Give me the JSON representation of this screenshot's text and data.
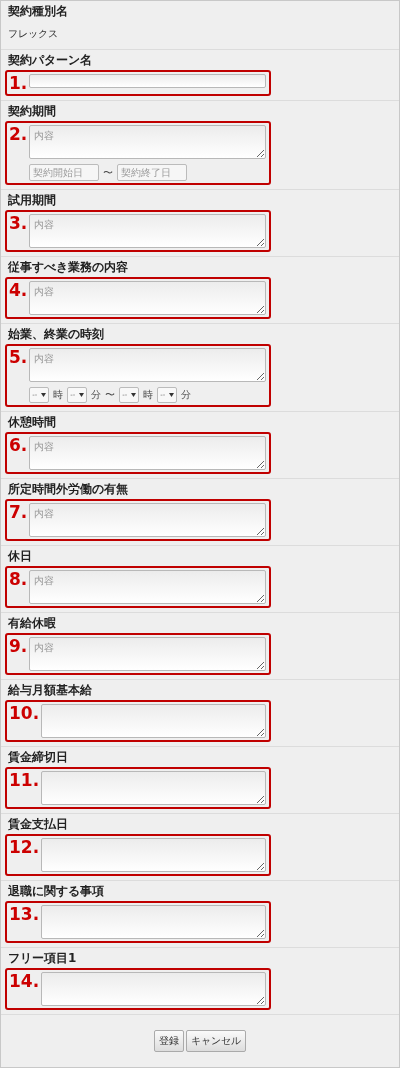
{
  "sections": [
    {
      "kind": "static",
      "label": "契約種別名",
      "value": "フレックス"
    },
    {
      "kind": "input",
      "label": "契約パターン名",
      "number": "1."
    },
    {
      "kind": "dates",
      "label": "契約期間",
      "number": "2.",
      "placeholder": "内容",
      "start_placeholder": "契約開始日",
      "separator": "〜",
      "end_placeholder": "契約終了日"
    },
    {
      "kind": "textarea",
      "label": "試用期間",
      "number": "3.",
      "placeholder": "内容"
    },
    {
      "kind": "textarea",
      "label": "従事すべき業務の内容",
      "number": "4.",
      "placeholder": "内容"
    },
    {
      "kind": "times",
      "label": "始業、終業の時刻",
      "number": "5.",
      "placeholder": "内容",
      "parts": [
        {
          "kind": "select",
          "value": "--"
        },
        {
          "kind": "text",
          "text": "時"
        },
        {
          "kind": "select",
          "value": "--"
        },
        {
          "kind": "text",
          "text": "分"
        },
        {
          "kind": "text",
          "text": "〜"
        },
        {
          "kind": "select",
          "value": "--"
        },
        {
          "kind": "text",
          "text": "時"
        },
        {
          "kind": "select",
          "value": "--"
        },
        {
          "kind": "text",
          "text": "分"
        }
      ]
    },
    {
      "kind": "textarea",
      "label": "休憩時間",
      "number": "6.",
      "placeholder": "内容"
    },
    {
      "kind": "textarea",
      "label": "所定時間外労働の有無",
      "number": "7.",
      "placeholder": "内容"
    },
    {
      "kind": "textarea",
      "label": "休日",
      "number": "8.",
      "placeholder": "内容"
    },
    {
      "kind": "textarea",
      "label": "有給休暇",
      "number": "9.",
      "placeholder": "内容"
    },
    {
      "kind": "textarea",
      "label": "給与月額基本給",
      "number": "10."
    },
    {
      "kind": "textarea",
      "label": "賃金締切日",
      "number": "11."
    },
    {
      "kind": "textarea",
      "label": "賃金支払日",
      "number": "12."
    },
    {
      "kind": "textarea",
      "label": "退職に関する事項",
      "number": "13."
    },
    {
      "kind": "textarea",
      "label": "フリー項目1",
      "number": "14."
    }
  ],
  "buttons": [
    "登録",
    "キャンセル"
  ]
}
